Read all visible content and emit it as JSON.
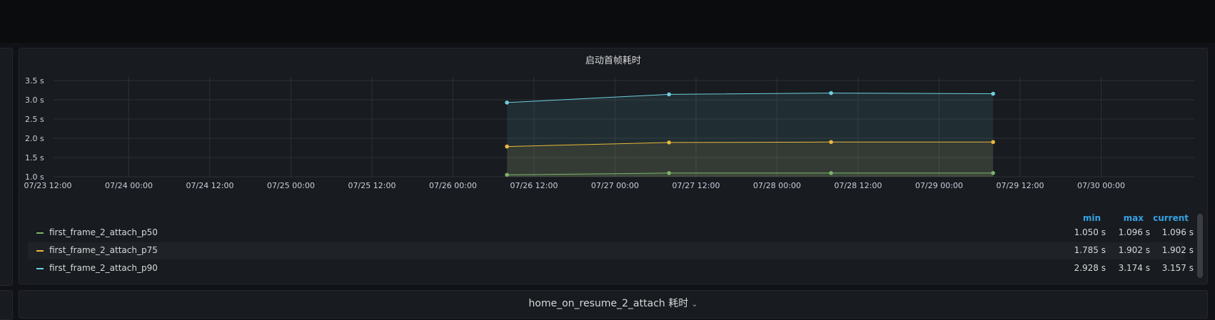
{
  "panel1": {
    "title": "启动首帧耗时"
  },
  "chart_data": {
    "type": "line",
    "title": "启动首帧耗时",
    "x_ticks": [
      "07/23 12:00",
      "07/24 00:00",
      "07/24 12:00",
      "07/25 00:00",
      "07/25 12:00",
      "07/26 00:00",
      "07/26 12:00",
      "07/27 00:00",
      "07/27 12:00",
      "07/28 00:00",
      "07/28 12:00",
      "07/29 00:00",
      "07/29 12:00",
      "07/30 00:00"
    ],
    "y_ticks": [
      "1.0 s",
      "1.5 s",
      "2.0 s",
      "2.5 s",
      "3.0 s",
      "3.5 s"
    ],
    "ylim": [
      1.0,
      3.5
    ],
    "xlim": [
      "2024-07-23 12:00",
      "2024-07-30 12:00"
    ],
    "x": [
      "2024-07-26 08:00",
      "2024-07-27 08:00",
      "2024-07-28 08:00",
      "2024-07-29 08:00"
    ],
    "series": [
      {
        "name": "first_frame_2_attach_p50",
        "color": "#7eb26d",
        "values": [
          1.05,
          1.096,
          1.096,
          1.096
        ]
      },
      {
        "name": "first_frame_2_attach_p75",
        "color": "#eab839",
        "values": [
          1.785,
          1.89,
          1.902,
          1.902
        ]
      },
      {
        "name": "first_frame_2_attach_p90",
        "color": "#6ed0e0",
        "values": [
          2.928,
          3.14,
          3.174,
          3.157
        ]
      }
    ],
    "grid": true,
    "legend": "bottom"
  },
  "legend": {
    "headers": {
      "min": "min",
      "max": "max",
      "current": "current"
    },
    "rows": [
      {
        "name": "first_frame_2_attach_p50",
        "min": "1.050 s",
        "max": "1.096 s",
        "current": "1.096 s"
      },
      {
        "name": "first_frame_2_attach_p75",
        "min": "1.785 s",
        "max": "1.902 s",
        "current": "1.902 s"
      },
      {
        "name": "first_frame_2_attach_p90",
        "min": "2.928 s",
        "max": "3.174 s",
        "current": "3.157 s"
      }
    ]
  },
  "panel2": {
    "title": "home_on_resume_2_attach 耗时",
    "caret_icon": "chevron-down-icon"
  }
}
